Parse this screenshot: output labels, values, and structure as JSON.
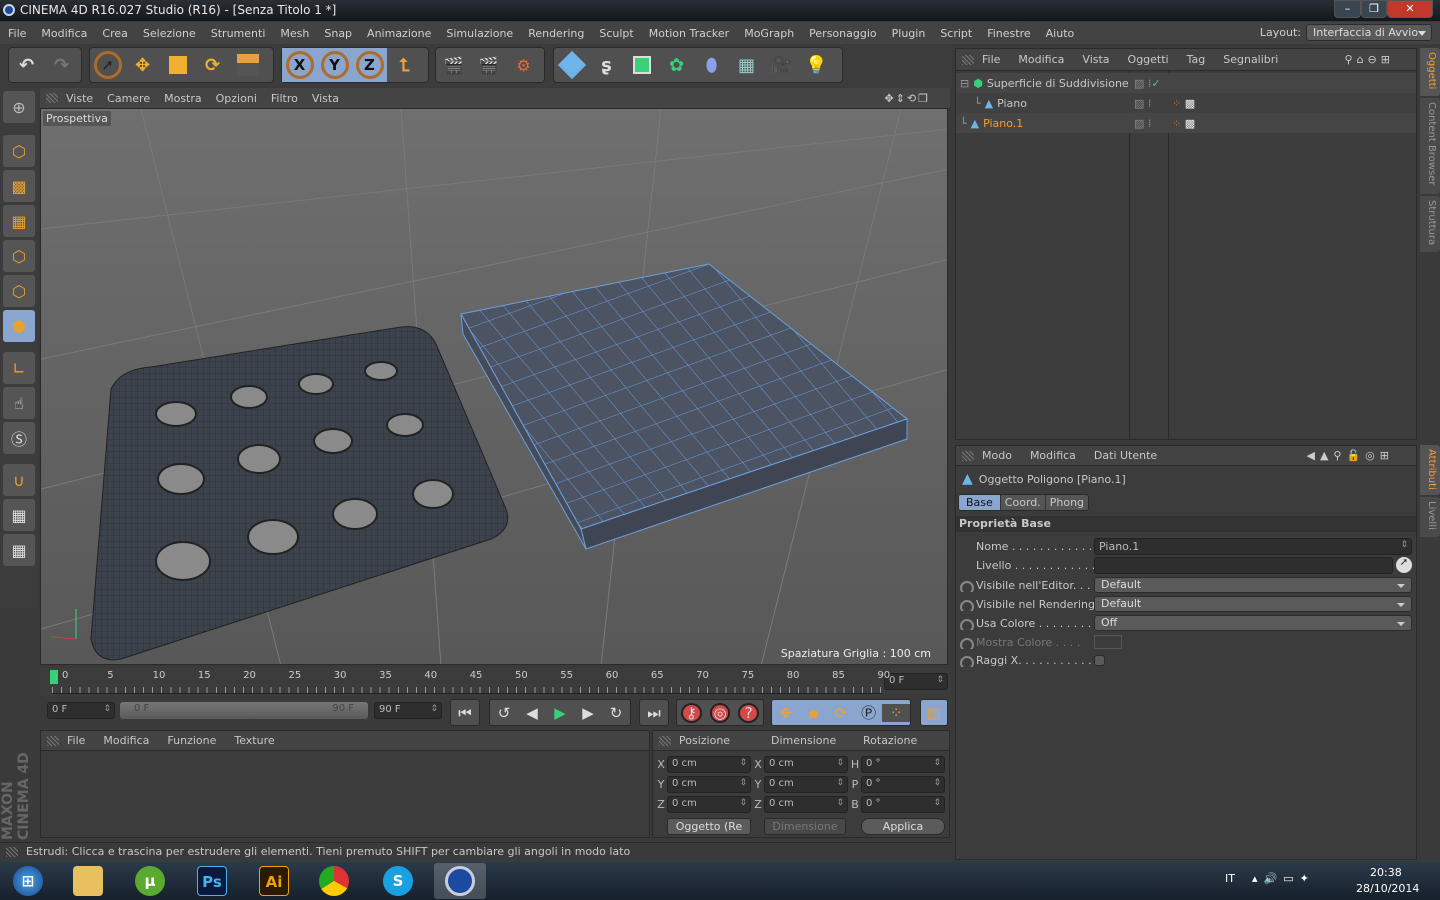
{
  "window": {
    "title": "CINEMA 4D R16.027 Studio (R16) - [Senza Titolo 1 *]",
    "minimize": "–",
    "maximize": "❐",
    "close": "✕"
  },
  "menu": [
    "File",
    "Modifica",
    "Crea",
    "Selezione",
    "Strumenti",
    "Mesh",
    "Snap",
    "Animazione",
    "Simulazione",
    "Rendering",
    "Sculpt",
    "Motion Tracker",
    "MoGraph",
    "Personaggio",
    "Plugin",
    "Script",
    "Finestre",
    "Aiuto"
  ],
  "layout": {
    "label": "Layout:",
    "value": "Interfaccia di Avvio"
  },
  "toolbar": {
    "axis_x": "X",
    "axis_y": "Y",
    "axis_z": "Z"
  },
  "viewport": {
    "menu": [
      "Viste",
      "Camere",
      "Mostra",
      "Opzioni",
      "Filtro",
      "Vista"
    ],
    "camera_label": "Prospettiva",
    "grid_spacing": "Spaziatura Griglia : 100 cm"
  },
  "timeline": {
    "ticks": [
      "0",
      "5",
      "10",
      "15",
      "20",
      "25",
      "30",
      "35",
      "40",
      "45",
      "50",
      "55",
      "60",
      "65",
      "70",
      "75",
      "80",
      "85",
      "90"
    ],
    "current": "0 F",
    "start": "0 F",
    "range_start": "0 F",
    "range_end": "90 F",
    "end": "90 F"
  },
  "materials": {
    "menu": [
      "File",
      "Modifica",
      "Funzione",
      "Texture"
    ]
  },
  "coords": {
    "headers": [
      "Posizione",
      "Dimensione",
      "Rotazione"
    ],
    "rows": [
      {
        "a": "X",
        "p": "0 cm",
        "b": "X",
        "d": "0 cm",
        "c": "H",
        "r": "0 °"
      },
      {
        "a": "Y",
        "p": "0 cm",
        "b": "Y",
        "d": "0 cm",
        "c": "P",
        "r": "0 °"
      },
      {
        "a": "Z",
        "p": "0 cm",
        "b": "Z",
        "d": "0 cm",
        "c": "B",
        "r": "0 °"
      }
    ],
    "mode": "Oggetto (Re",
    "size_mode": "Dimensione",
    "apply": "Applica"
  },
  "status": "Estrudi: Clicca e trascina per estrudere gli elementi. Tieni premuto SHIFT per cambiare gli angoli in modo lato",
  "brand": "MAXON CINEMA 4D",
  "objects": {
    "menu": [
      "File",
      "Modifica",
      "Vista",
      "Oggetti",
      "Tag",
      "Segnalibri"
    ],
    "items": [
      {
        "name": "Superficie di Suddivisione",
        "indent": 0
      },
      {
        "name": "Piano",
        "indent": 1
      },
      {
        "name": "Piano.1",
        "indent": 0,
        "selected": true
      }
    ]
  },
  "attributes": {
    "menu": [
      "Modo",
      "Modifica",
      "Dati Utente"
    ],
    "object": "Oggetto Poligono [Piano.1]",
    "tabs": [
      "Base",
      "Coord.",
      "Phong"
    ],
    "active_tab": "Base",
    "section": "Proprietà Base",
    "fields": {
      "nome_label": "Nome . . . . . . . . . . . . . .",
      "nome": "Piano.1",
      "livello_label": "Livello . . . . . . . . . . . . .",
      "vis_editor_label": "Visibile nell'Editor. . . .",
      "vis_editor": "Default",
      "vis_render_label": "Visibile nel Rendering",
      "vis_render": "Default",
      "usa_colore_label": "Usa Colore . . . . . . . . . .",
      "usa_colore": "Off",
      "mostra_colore_label": "Mostra Colore . . . .",
      "raggi_label": "Raggi X. . . . . . . . . . . . ."
    }
  },
  "side_tabs": {
    "objects": "Oggetti",
    "content": "Content Browser",
    "structure": "Struttura",
    "attributes": "Attributi",
    "layers": "Livelli"
  },
  "taskbar": {
    "lang": "IT",
    "time": "20:38",
    "date": "28/10/2014",
    "apps": [
      "Ps",
      "Ai",
      "S"
    ]
  },
  "colors": {
    "accent": "#8aa6cf",
    "selected_text": "#f0a030",
    "play_green": "#3ad07a"
  }
}
